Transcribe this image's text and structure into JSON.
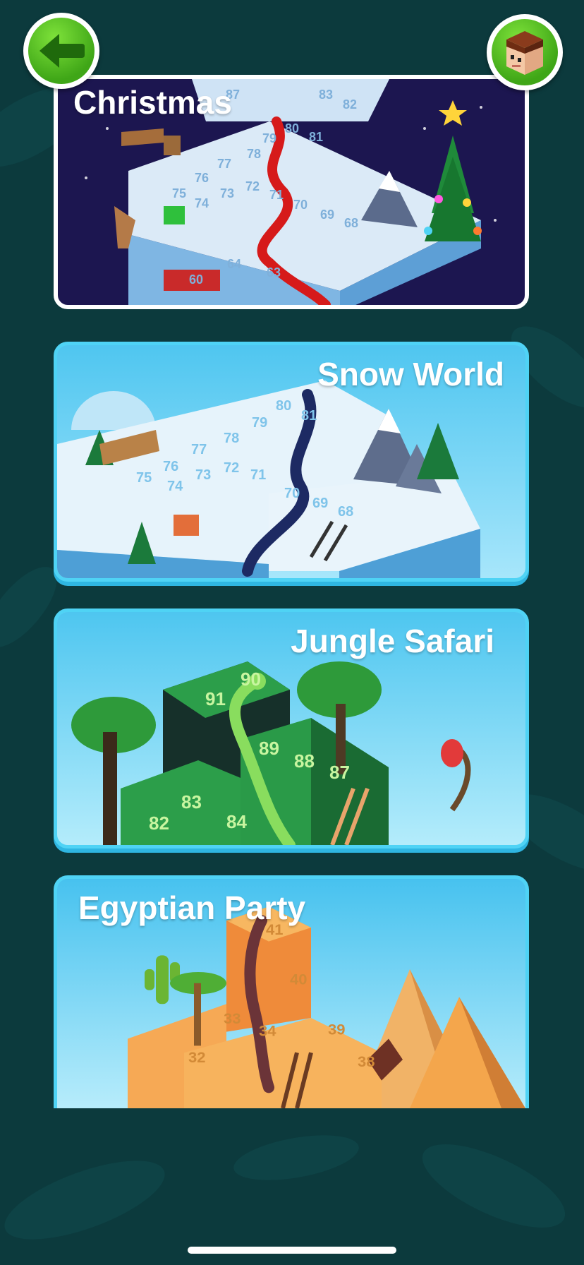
{
  "header": {
    "back_icon": "arrow-left-icon",
    "avatar_icon": "blocky-avatar-icon"
  },
  "worlds": [
    {
      "id": "christmas",
      "title": "Christmas",
      "board_numbers": [
        "87",
        "83",
        "82",
        "80",
        "81",
        "79",
        "78",
        "77",
        "76",
        "75",
        "74",
        "73",
        "72",
        "71",
        "70",
        "69",
        "68",
        "64",
        "63",
        "60"
      ]
    },
    {
      "id": "snow",
      "title": "Snow World",
      "board_numbers": [
        "80",
        "81",
        "79",
        "78",
        "77",
        "76",
        "75",
        "74",
        "73",
        "72",
        "71",
        "70",
        "69",
        "68"
      ]
    },
    {
      "id": "jungle",
      "title": "Jungle Safari",
      "board_numbers": [
        "90",
        "91",
        "89",
        "88",
        "87",
        "83",
        "82",
        "84"
      ]
    },
    {
      "id": "egypt",
      "title": "Egyptian Party",
      "board_numbers": [
        "41",
        "40",
        "33",
        "34",
        "39",
        "32",
        "38"
      ]
    }
  ],
  "colors": {
    "background": "#0c3a3d",
    "accent_green": "#4cb81e",
    "card_border_blue": "#4fd3f5",
    "christmas_bg": "#1c1650"
  }
}
